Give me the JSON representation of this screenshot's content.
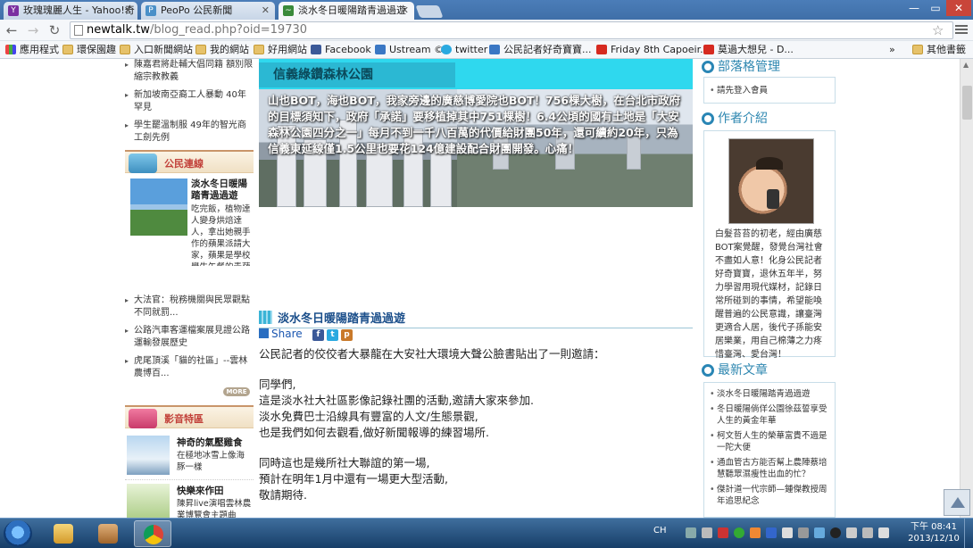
{
  "tabs": [
    {
      "label": "玫瑰瑰麗人生 - Yahoo!奇",
      "favicon_color": "#7b2fa0",
      "favicon_glyph": "Y"
    },
    {
      "label": "PeoPo 公民新聞",
      "favicon_color": "#4a90c8",
      "favicon_glyph": "P"
    },
    {
      "label": "淡水冬日暖陽踏青過過遊",
      "favicon_color": "#3a8a3a",
      "favicon_glyph": "~"
    }
  ],
  "toolbar": {
    "url_host": "newtalk.tw",
    "url_path": "/blog_read.php?oid=19730"
  },
  "bookmarks": [
    {
      "label": "應用程式",
      "icon": "apps-icon"
    },
    {
      "label": "環保園趣",
      "icon": "folder-icon"
    },
    {
      "label": "入口新聞網站",
      "icon": "folder-icon"
    },
    {
      "label": "我的網站",
      "icon": "folder-icon"
    },
    {
      "label": "好用網站",
      "icon": "folder-icon"
    },
    {
      "label": "Facebook",
      "icon": "facebook-icon"
    },
    {
      "label": "Ustream ©",
      "icon": "ustream-icon"
    },
    {
      "label": "twitter",
      "icon": "twitter-icon"
    },
    {
      "label": "公民記者好奇寶寶...",
      "icon": "ustream-icon"
    },
    {
      "label": "Friday 8th Capoeir...",
      "icon": "youtube-icon"
    },
    {
      "label": "莫過大想兒 - D...",
      "icon": "youtube-icon"
    },
    {
      "label": "»",
      "icon": ""
    },
    {
      "label": "其他書籤",
      "icon": "folder-icon"
    }
  ],
  "left": {
    "top_news": [
      "陳嘉君將赴輔大倡同籍 額別限縮宗教教義",
      "新加坡南亞裔工人暴動 40年罕見",
      "學生罷溫制服 49年的智光商工劍先例"
    ],
    "civic_links_title": "公民連線",
    "featured": {
      "title": "淡水冬日暖陽踏青過過遊",
      "excerpt": "吃完飯，植物達人變身烘焙達人，拿出她親手作的蘋果派請大家，蘋果是學校學生午餐的青蘋果 ......more"
    },
    "links": [
      "大法官：稅務機關與民眾觀點不同就罰...",
      "公路汽車客運檔案展見證公路運輸發展歷史",
      "虎尾頂溪「貓的社區」--雲林農博百..."
    ],
    "more_label": "MORE",
    "media_title": "影音特區",
    "media": [
      {
        "title": "神奇的氣壓雞食",
        "desc": "在極地冰雪上像海豚一樣"
      },
      {
        "title": "快樂來作田",
        "desc": "陳昇live演唱雲林農業博覽會主題曲"
      }
    ]
  },
  "center": {
    "banner_title": "信義綠鑽森林公園",
    "banner_text": "山也BOT，海也BOT，我家旁邊的廣慈博愛院也BOT！756棵大樹，在台北市政府的目標須知下，政府「承諾」要移植掉其中751棵樹！6.4公頃的國有土地是「大安森林公園四分之一」每月不到一千八百萬的代價給財團50年，還可續約20年，只為信義東延線僅1.5公里也要花124億建設配合財團開發。心痛！",
    "article_title": "淡水冬日暖陽踏青過過遊",
    "share_label": "Share",
    "intro": "公民記者的佼佼者大暴龍在大安社大環境大聲公臉書貼出了一則邀請：",
    "letter": [
      "同學們,",
      "這是淡水社大社區影像記錄社團的活動,邀請大家來參加.",
      "淡水免費巴士沿線具有豐富的人文/生態景觀,",
      "也是我們如何去觀看,做好新聞報導的練習場所."
    ],
    "letter2": [
      "同時這也是幾所社大聯誼的第一場,",
      "預計在明年1月中還有一場更大型活動,",
      "敬請期待."
    ]
  },
  "right": {
    "blog_admin_title": "部落格管理",
    "login_label": "請先登入會員",
    "author_title": "作者介紹",
    "author_bio": "白髮苔苔的初老，經由廣慈BOT案覺醒，發覺台灣社會不盡如人意！化身公民記者好奇寶寶，退休五年半，努力學習用現代媒材，記錄日常所碰到的事情，希望能喚醒普遍的公民意識，讓臺灣更適合人居，後代子孫能安居樂業，用自己棉薄之力疼惜臺灣、愛台灣！",
    "latest_title": "最新文章",
    "latest": [
      "淡水冬日暖陽踏青過過遊",
      "冬日暖陽倘佯公園徐茲誓享受人生的黃金年華",
      "柯文哲人生的榮華富貴不過是一陀大便",
      "通血管古方能否幫上農陣蔡培慧聽眾濕瘦性出血的忙？",
      "傑計道一代宗師—鍾傑教授周年追思紀念"
    ]
  },
  "taskbar": {
    "ime": "CH",
    "time": "下午 08:41",
    "date": "2013/12/10"
  }
}
